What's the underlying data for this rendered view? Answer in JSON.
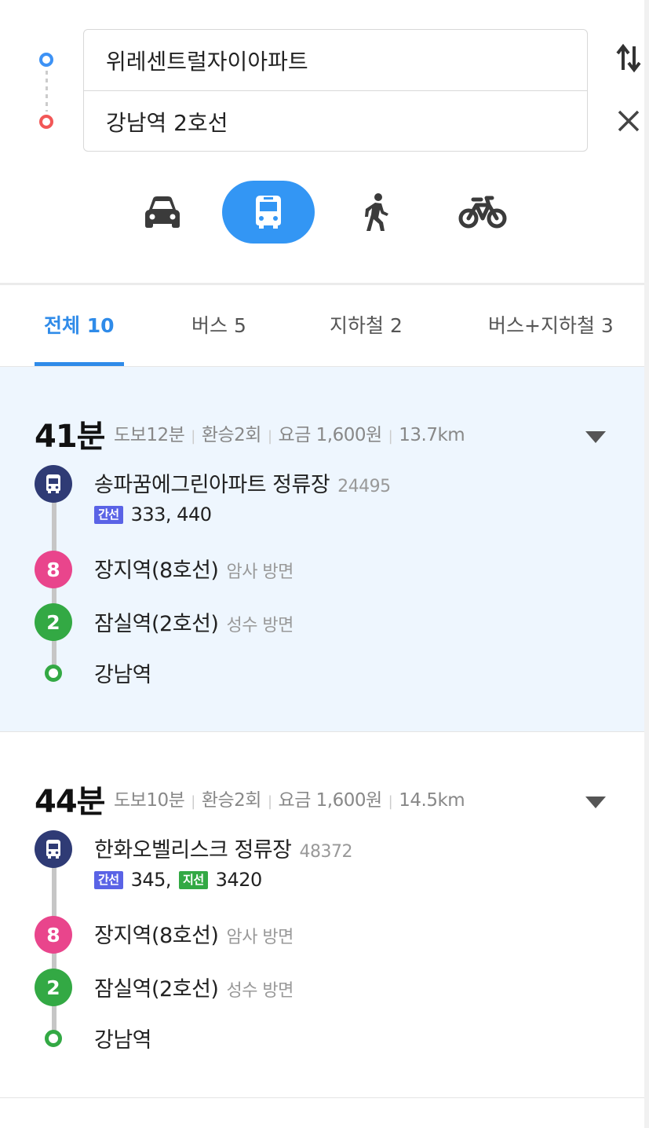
{
  "search": {
    "origin": "위레센트럴자이아파트",
    "destination": "강남역 2호선"
  },
  "modes": [
    {
      "name": "car-icon",
      "selected": false
    },
    {
      "name": "bus-icon",
      "selected": true
    },
    {
      "name": "walk-icon",
      "selected": false
    },
    {
      "name": "bike-icon",
      "selected": false
    }
  ],
  "tabs": [
    {
      "label": "전체 10",
      "active": true
    },
    {
      "label": "버스 5",
      "active": false
    },
    {
      "label": "지하철 2",
      "active": false
    },
    {
      "label": "버스+지하철 3",
      "active": false
    }
  ],
  "routes": [
    {
      "duration": "41분",
      "walk": "도보12분",
      "transfers": "환승2회",
      "fare": "요금 1,600원",
      "distance": "13.7km",
      "stops": {
        "bus_stop": {
          "name": "송파꿈에그린아파트 정류장",
          "id": "24495",
          "tag": "간선",
          "lines": "333, 440"
        },
        "line8": {
          "badge": "8",
          "name": "장지역(8호선)",
          "direction": "암사 방면"
        },
        "line2": {
          "badge": "2",
          "name": "잠실역(2호선)",
          "direction": "성수 방면"
        },
        "end": {
          "name": "강남역"
        }
      }
    },
    {
      "duration": "44분",
      "walk": "도보10분",
      "transfers": "환승2회",
      "fare": "요금 1,600원",
      "distance": "14.5km",
      "stops": {
        "bus_stop": {
          "name": "한화오벨리스크 정류장",
          "id": "48372",
          "tag": "간선",
          "lines": "345,",
          "tag2": "지선",
          "lines2": "3420"
        },
        "line8": {
          "badge": "8",
          "name": "장지역(8호선)",
          "direction": "암사 방면"
        },
        "line2": {
          "badge": "2",
          "name": "잠실역(2호선)",
          "direction": "성수 방면"
        },
        "end": {
          "name": "강남역"
        }
      }
    }
  ],
  "colors": {
    "accent": "#2f8be9",
    "transit_mode": "#3396f4",
    "highlight_bg": "#eef6fe",
    "bus_badge": "#2f3b75",
    "line8": "#e9458c",
    "line2": "#33a944",
    "trunk_tag": "#5a63e6",
    "branch_tag": "#33a944"
  }
}
